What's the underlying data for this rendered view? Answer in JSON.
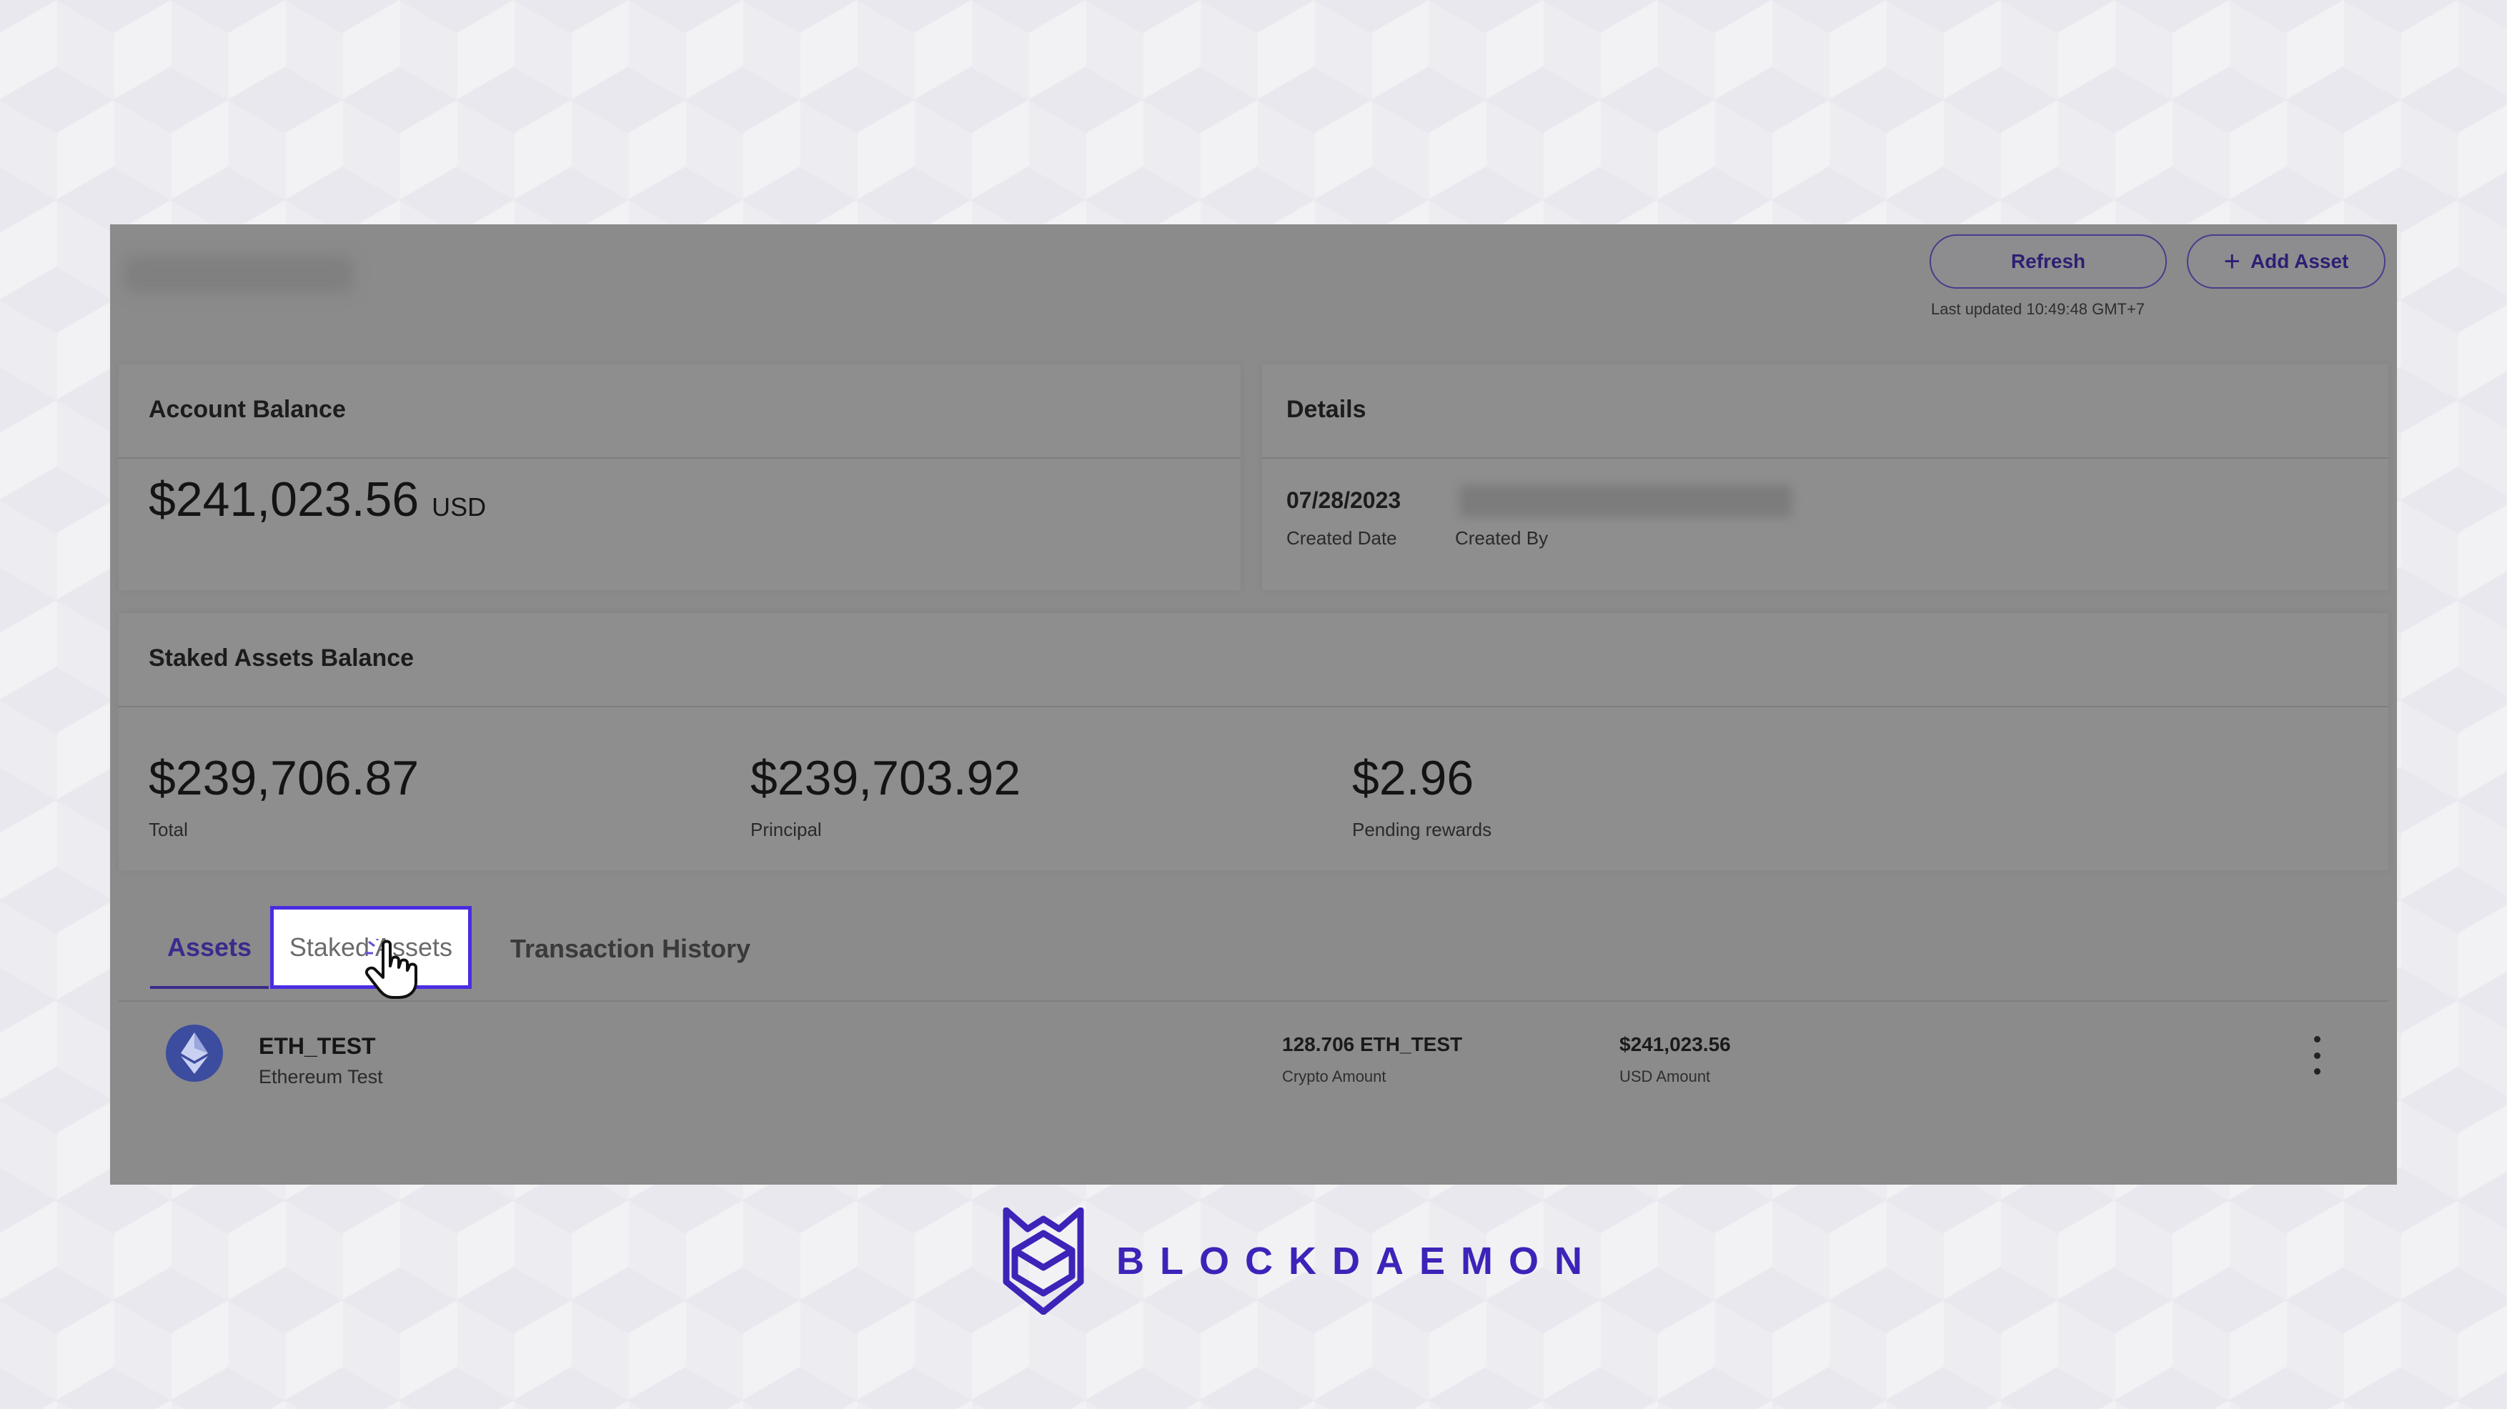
{
  "header": {
    "refresh_label": "Refresh",
    "add_asset_label": "Add Asset",
    "last_updated": "Last updated 10:49:48 GMT+7"
  },
  "account_balance": {
    "title": "Account Balance",
    "value": "$241,023.56",
    "unit": "USD"
  },
  "details": {
    "title": "Details",
    "created_date_value": "07/28/2023",
    "created_date_label": "Created Date",
    "created_by_label": "Created By"
  },
  "staked_balance": {
    "title": "Staked Assets Balance",
    "total_value": "$239,706.87",
    "total_label": "Total",
    "principal_value": "$239,703.92",
    "principal_label": "Principal",
    "pending_value": "$2.96",
    "pending_label": "Pending rewards"
  },
  "tabs": {
    "assets": "Assets",
    "staked": "Staked Assets",
    "history": "Transaction History",
    "active": "Assets"
  },
  "asset_rows": [
    {
      "symbol": "ETH_TEST",
      "name": "Ethereum Test",
      "crypto_amount": "128.706 ETH_TEST",
      "crypto_amount_label": "Crypto Amount",
      "usd_amount": "$241,023.56",
      "usd_amount_label": "USD Amount"
    }
  ],
  "brand": {
    "name": "BLOCKDAEMON",
    "color": "#3d23b8"
  },
  "colors": {
    "accent": "#3b2a8c",
    "highlight_border": "#4b2ce0"
  }
}
